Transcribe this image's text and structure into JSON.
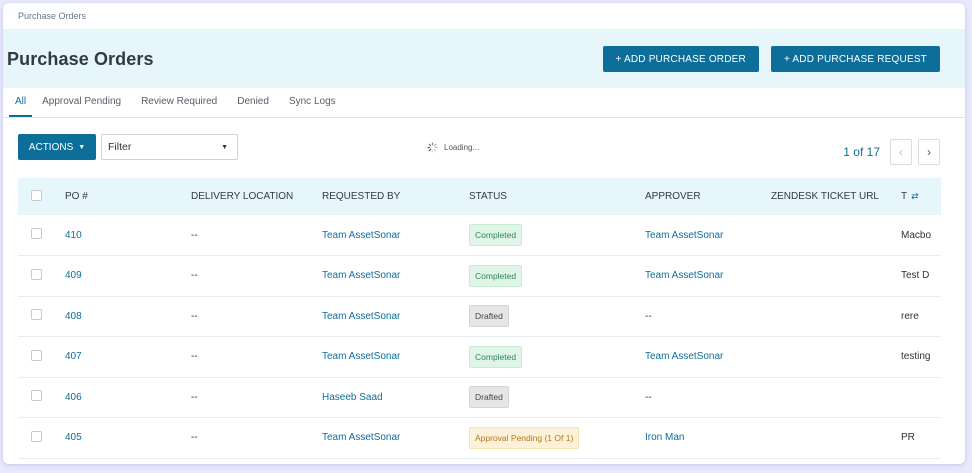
{
  "breadcrumb": "Purchase Orders",
  "page_title": "Purchase Orders",
  "header": {
    "add_purchase_order": "+ ADD PURCHASE ORDER",
    "add_purchase_request": "+ ADD PURCHASE REQUEST"
  },
  "tabs": [
    "All",
    "Approval Pending",
    "Review Required",
    "Denied",
    "Sync Logs"
  ],
  "toolbar": {
    "actions_label": "ACTIONS",
    "filter_value": "Filter",
    "loading_text": "Loading...",
    "page_info": "1 of 17"
  },
  "columns": [
    "PO #",
    "DELIVERY LOCATION",
    "REQUESTED BY",
    "STATUS",
    "APPROVER",
    "ZENDESK TICKET URL",
    "T"
  ],
  "rows": [
    {
      "po": "410",
      "delivery": "--",
      "requested_by": "Team AssetSonar",
      "status": "Completed",
      "status_type": "completed",
      "approver": "Team AssetSonar",
      "zendesk": "",
      "title": "Macbo"
    },
    {
      "po": "409",
      "delivery": "--",
      "requested_by": "Team AssetSonar",
      "status": "Completed",
      "status_type": "completed",
      "approver": "Team AssetSonar",
      "zendesk": "",
      "title": "Test D"
    },
    {
      "po": "408",
      "delivery": "--",
      "requested_by": "Team AssetSonar",
      "status": "Drafted",
      "status_type": "drafted",
      "approver": "--",
      "zendesk": "",
      "title": "rere"
    },
    {
      "po": "407",
      "delivery": "--",
      "requested_by": "Team AssetSonar",
      "status": "Completed",
      "status_type": "completed",
      "approver": "Team AssetSonar",
      "zendesk": "",
      "title": "testing"
    },
    {
      "po": "406",
      "delivery": "--",
      "requested_by": "Haseeb Saad",
      "status": "Drafted",
      "status_type": "drafted",
      "approver": "--",
      "zendesk": "",
      "title": ""
    },
    {
      "po": "405",
      "delivery": "--",
      "requested_by": "Team AssetSonar",
      "status": "Approval Pending (1 Of 1)",
      "status_type": "pending",
      "approver": "Iron Man",
      "zendesk": "",
      "title": "PR"
    }
  ],
  "icons": {
    "actions_caret": "caret-down-icon",
    "filter_caret": "caret-down-icon",
    "loading": "spinner-icon",
    "prev": "chevron-left-icon",
    "next": "chevron-right-icon",
    "column_settings": "column-settings-icon"
  },
  "colors": {
    "primary": "#0d6e9a",
    "header_bg": "#e6f6fb",
    "completed_bg": "#dff5e7",
    "drafted_bg": "#e6e6e6",
    "pending_bg": "#fdf2d9"
  }
}
